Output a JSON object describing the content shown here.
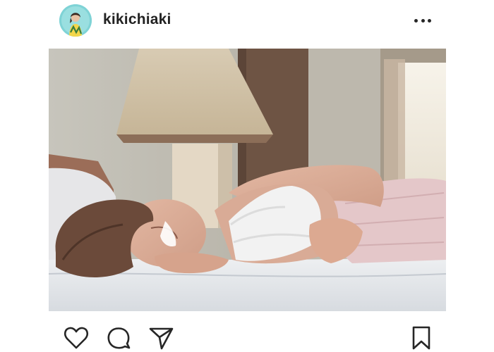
{
  "post": {
    "username": "kikichiaki",
    "avatar_icon": "profile-avatar",
    "more_icon": "more-options-icon",
    "photo_description_icon": "post-photo",
    "actions": {
      "like_icon": "heart-icon",
      "comment_icon": "comment-bubble-icon",
      "share_icon": "send-paper-plane-icon",
      "save_icon": "bookmark-icon"
    }
  },
  "colors": {
    "text": "#262626",
    "background": "#ffffff",
    "avatar_bg": "#7fd3d6"
  }
}
